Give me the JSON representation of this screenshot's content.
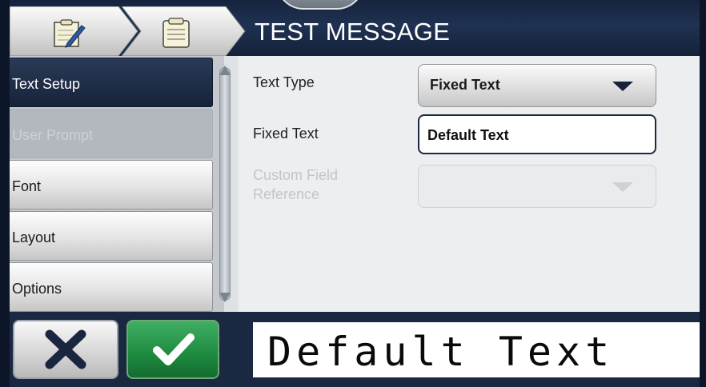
{
  "header": {
    "title": "TEST MESSAGE",
    "breadcrumb_icons": [
      "edit-message-icon",
      "message-document-icon"
    ]
  },
  "sidebar": {
    "items": [
      {
        "label": "Text Setup",
        "state": "active"
      },
      {
        "label": "User Prompt",
        "state": "disabled"
      },
      {
        "label": "Font",
        "state": "normal"
      },
      {
        "label": "Layout",
        "state": "normal"
      },
      {
        "label": "Options",
        "state": "normal"
      }
    ]
  },
  "form": {
    "text_type_label": "Text Type",
    "text_type_value": "Fixed Text",
    "fixed_text_label": "Fixed Text",
    "fixed_text_value": "Default Text",
    "custom_field_label_line1": "Custom Field",
    "custom_field_label_line2": "Reference",
    "custom_field_value": ""
  },
  "footer": {
    "cancel_icon": "close-icon",
    "ok_icon": "check-icon",
    "preview_text": "Default Text"
  },
  "colors": {
    "header_bg": "#1f3252",
    "active_item": "#1d2a44",
    "ok_green": "#1d8a3f",
    "footer_bg": "#1b2841"
  }
}
